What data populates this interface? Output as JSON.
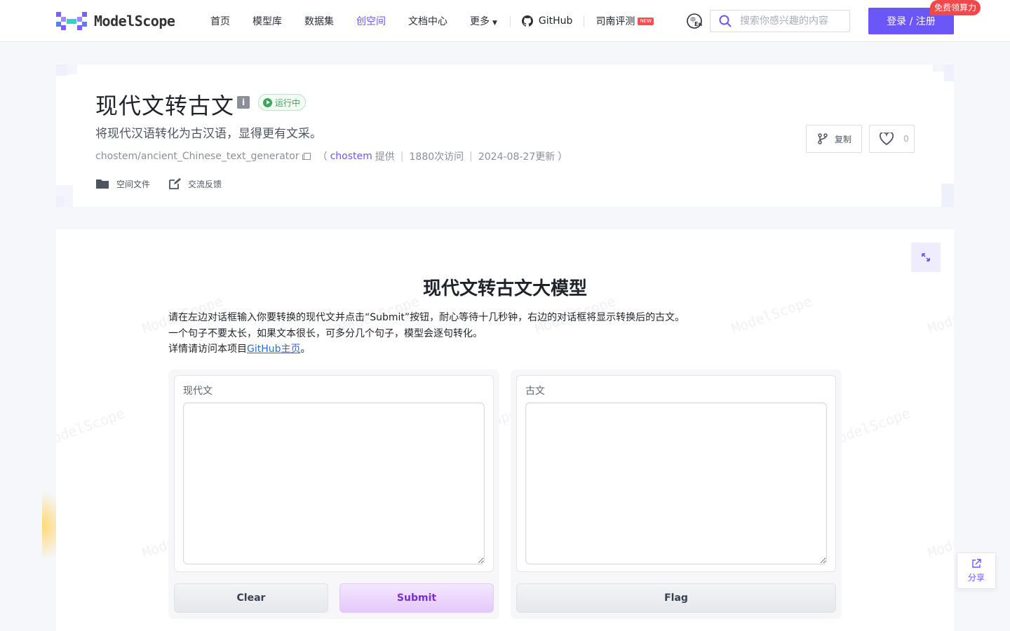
{
  "nav": {
    "logo_text": "ModelScope",
    "items": [
      {
        "label": "首页"
      },
      {
        "label": "模型库"
      },
      {
        "label": "数据集"
      },
      {
        "label": "创空间",
        "active": true
      },
      {
        "label": "文档中心"
      },
      {
        "label": "更多",
        "has_dropdown": true
      }
    ],
    "github_label": "GitHub",
    "eval_label": "司南评测",
    "eval_badge": "NEW",
    "lang_icon": "translate-icon",
    "search_placeholder": "搜索你感兴趣的内容",
    "login_label": "登录 / 注册",
    "free_tag": "免费领算力"
  },
  "space": {
    "title": "现代文转古文",
    "info_badge": "i",
    "status": "运行中",
    "description": "将现代汉语转化为古汉语，显得更有文采。",
    "repo_path": "chostem/ancient_Chinese_text_generator",
    "open_paren": "（",
    "author": "chostem",
    "provided": "提供",
    "visits": "1880次访问",
    "updated": "2024-08-27更新",
    "close_paren": "）",
    "tabs": [
      {
        "label": "空间文件",
        "icon": "folder-icon"
      },
      {
        "label": "交流反馈",
        "icon": "edit-icon"
      }
    ],
    "fork_label": "复制",
    "like_count": "0"
  },
  "app": {
    "title": "现代文转古文大模型",
    "desc_line1": "请在左边对话框输入你要转换的现代文并点击“Submit”按钮，耐心等待十几秒钟，右边的对话框将显示转换后的古文。",
    "desc_line2": "一个句子不要太长，如果文本很长，可多分几个句子，模型会逐句转化。",
    "desc_line3_prefix": "详情请访问本项目",
    "desc_link": "GitHub主页",
    "desc_line3_suffix": "。",
    "watermark": "ModelScope",
    "input_label": "现代文",
    "input_value": "",
    "output_label": "古文",
    "output_value": "",
    "clear_label": "Clear",
    "submit_label": "Submit",
    "flag_label": "Flag"
  },
  "share_label": "分享",
  "colors": {
    "accent": "#6b57f5",
    "status_green": "#3aa85b",
    "free_tag_red": "#f0484b",
    "submit_purple": "#7a2fd6"
  }
}
